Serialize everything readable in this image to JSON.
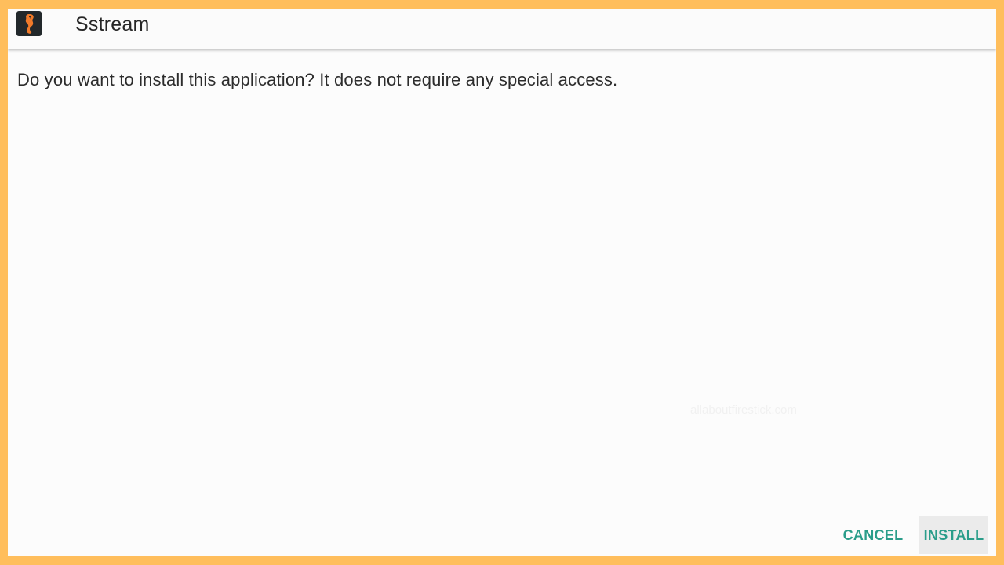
{
  "app": {
    "title": "Sstream",
    "icon": "seahorse-logo-icon",
    "icon_bg": "#22282b",
    "icon_accent": "#f07a2a"
  },
  "dialog": {
    "message": "Do you want to install this application? It does not require any special access."
  },
  "watermark": "allaboutfirestick.com",
  "buttons": {
    "cancel_label": "CANCEL",
    "install_label": "INSTALL"
  },
  "colors": {
    "frame_border": "#ffbe5c",
    "accent": "#2a9d8a",
    "focused_button_bg": "#ebebeb"
  }
}
